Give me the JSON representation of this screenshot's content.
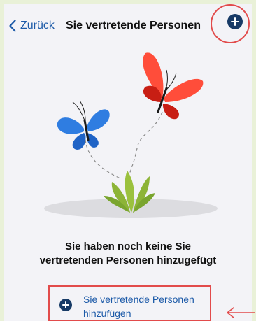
{
  "header": {
    "back_label": "Zurück",
    "title": "Sie vertretende Personen"
  },
  "empty_state": {
    "line1": "Sie haben noch keine Sie",
    "line2": "vertretenden Personen hinzugefügt"
  },
  "add_button": {
    "line1": "Sie vertretende Personen",
    "line2": "hinzufügen"
  },
  "colors": {
    "accent": "#173a66",
    "link": "#1c5aa8",
    "highlight": "#e24b4b"
  }
}
